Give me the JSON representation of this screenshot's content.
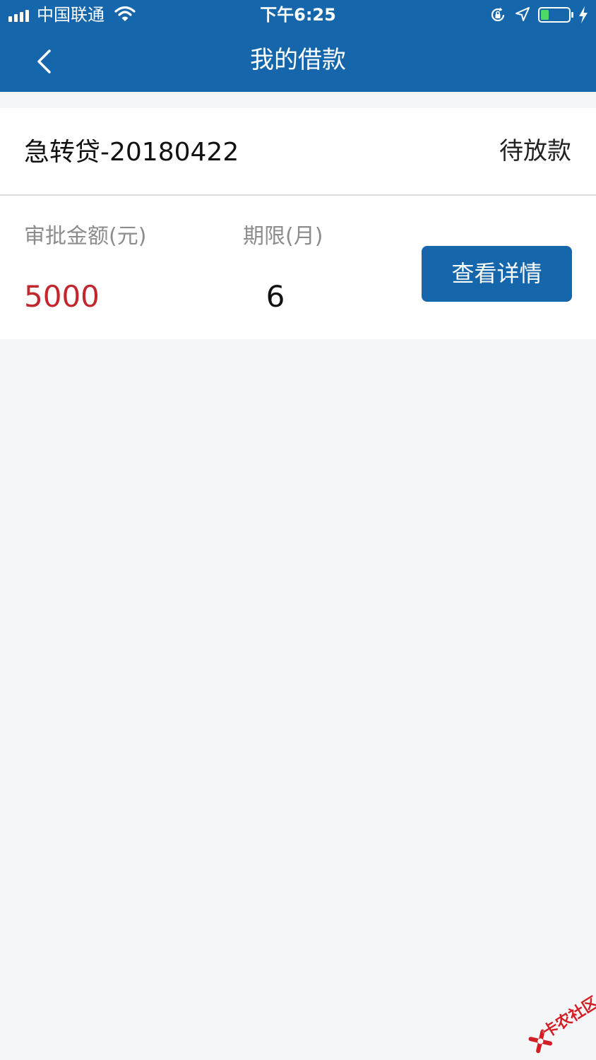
{
  "status_bar": {
    "carrier": "中国联通",
    "time": "下午6:25",
    "icons": [
      "signal-icon",
      "wifi-icon",
      "rotation-lock-icon",
      "location-icon",
      "battery-icon",
      "charging-bolt-icon"
    ]
  },
  "nav": {
    "back_icon": "chevron-left-icon",
    "title": "我的借款"
  },
  "loan": {
    "name": "急转贷-20180422",
    "status": "待放款",
    "amount_label": "审批金额(元)",
    "amount_value": "5000",
    "term_label": "期限(月)",
    "term_value": "6",
    "detail_button": "查看详情"
  },
  "watermark": {
    "text": "卡农社区",
    "logo_icon": "kanong-logo-icon"
  },
  "colors": {
    "header": "#1566aa",
    "amount": "#c2272d",
    "background": "#f5f6f8",
    "watermark": "#d21f26"
  }
}
